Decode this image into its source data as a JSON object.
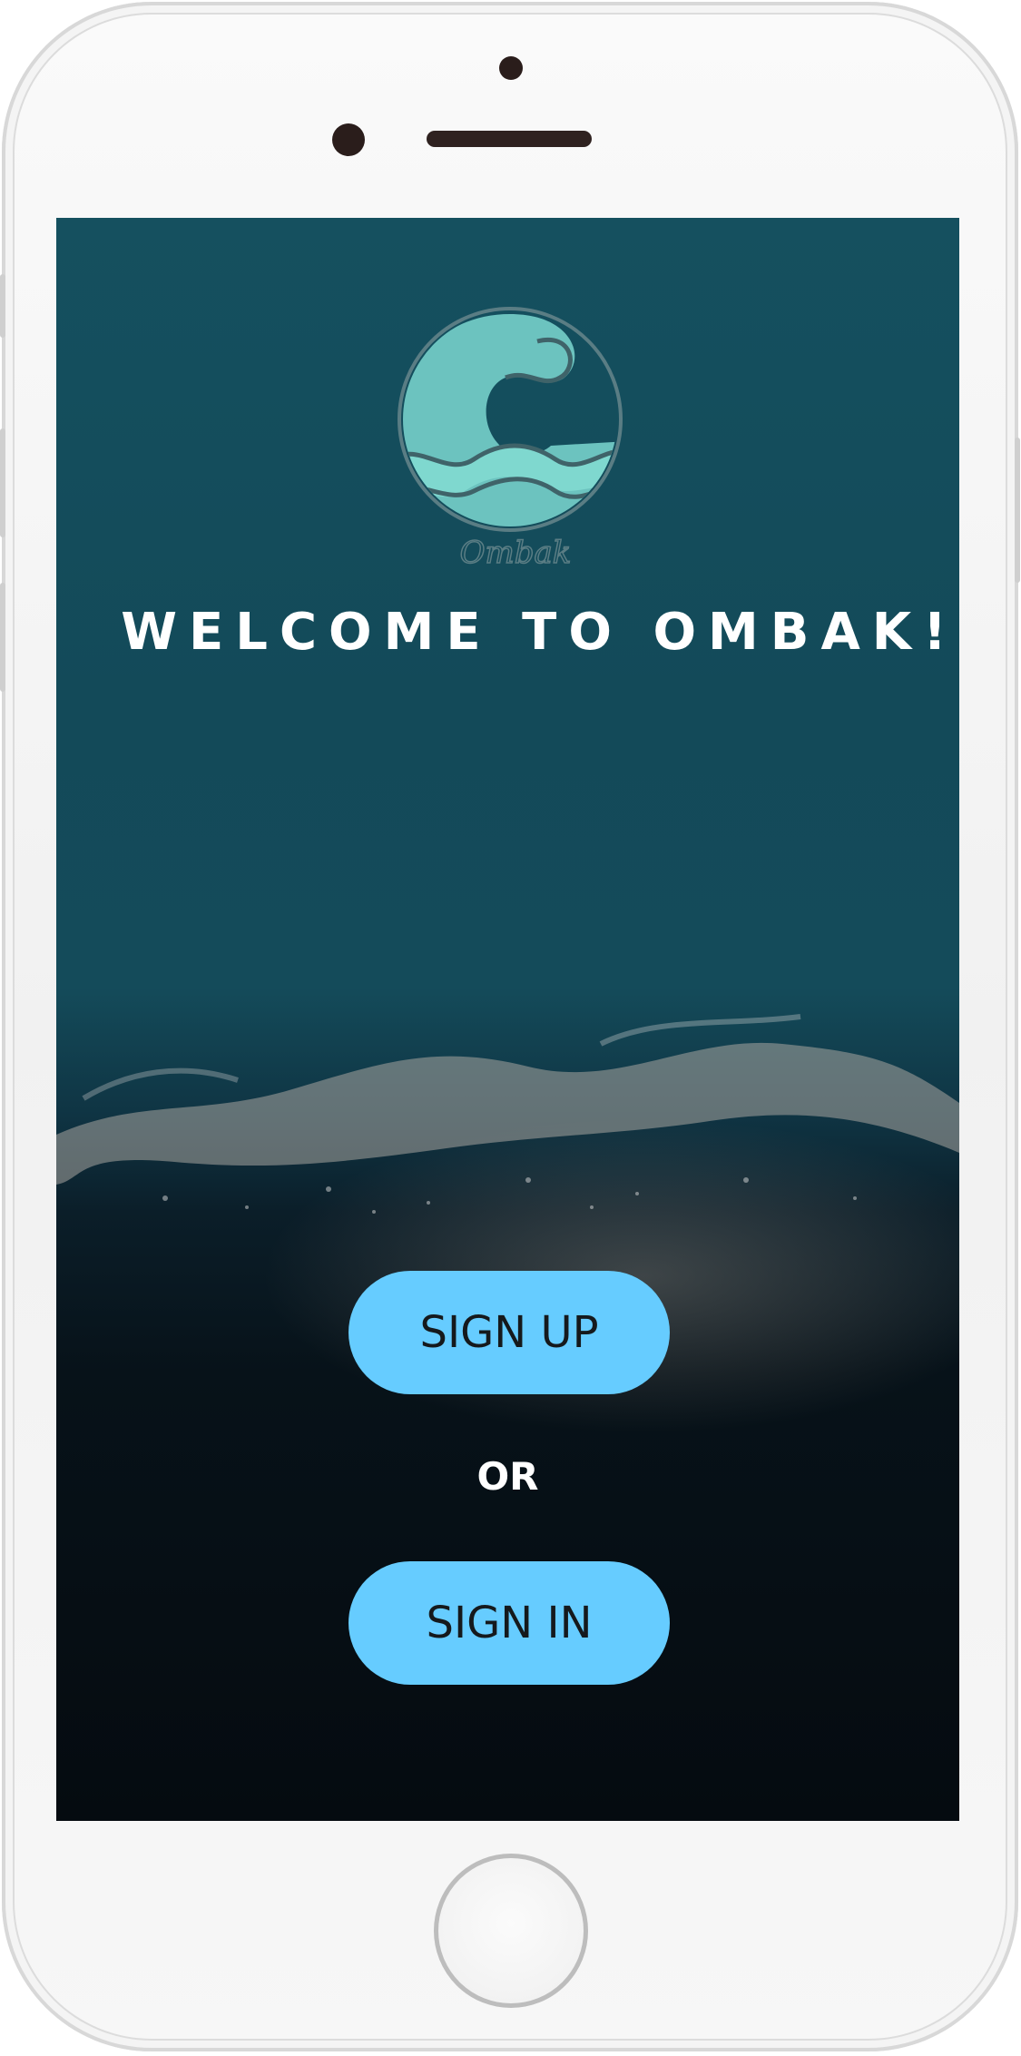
{
  "app": {
    "logo_text": "Ombak",
    "welcome_title": "WELCOME TO OMBAK!"
  },
  "actions": {
    "sign_up_label": "SIGN UP",
    "or_label": "OR",
    "sign_in_label": "SIGN IN"
  },
  "colors": {
    "button_bg": "#66ccff",
    "button_text": "#15191c",
    "logo_fill": "#6cc3bf",
    "ocean_top": "#15505f",
    "sand_dark": "#050b10"
  }
}
